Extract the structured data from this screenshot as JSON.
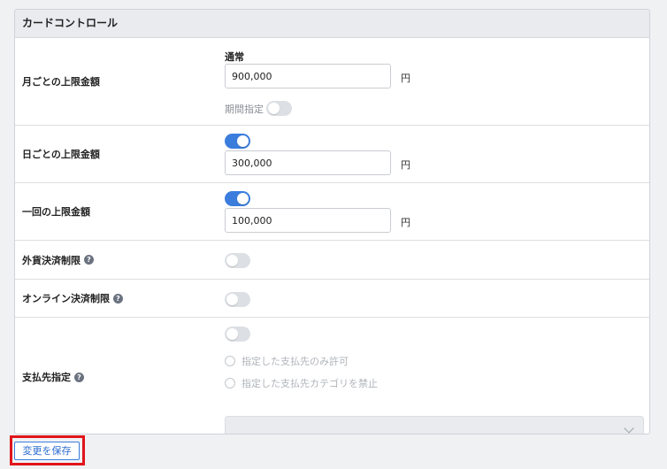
{
  "panel": {
    "title": "カードコントロール"
  },
  "monthly": {
    "label": "月ごとの上限金額",
    "sublabel": "通常",
    "value": "900,000",
    "unit": "円",
    "period_label": "期間指定",
    "period_enabled": false
  },
  "daily": {
    "label": "日ごとの上限金額",
    "enabled": true,
    "value": "300,000",
    "unit": "円"
  },
  "per_transaction": {
    "label": "一回の上限金額",
    "enabled": true,
    "value": "100,000",
    "unit": "円"
  },
  "foreign_currency": {
    "label": "外貨決済制限",
    "help": "?",
    "enabled": false
  },
  "online": {
    "label": "オンライン決済制限",
    "help": "?",
    "enabled": false
  },
  "payee": {
    "label": "支払先指定",
    "help": "?",
    "enabled": false,
    "options": [
      "指定した支払先のみ許可",
      "指定した支払先カテゴリを禁止"
    ],
    "select_value": ""
  },
  "save_button": {
    "label": "変更を保存"
  },
  "colors": {
    "accent": "#3b7ddd",
    "highlight": "#e0151b",
    "toggle_off": "#dcdfe4"
  }
}
